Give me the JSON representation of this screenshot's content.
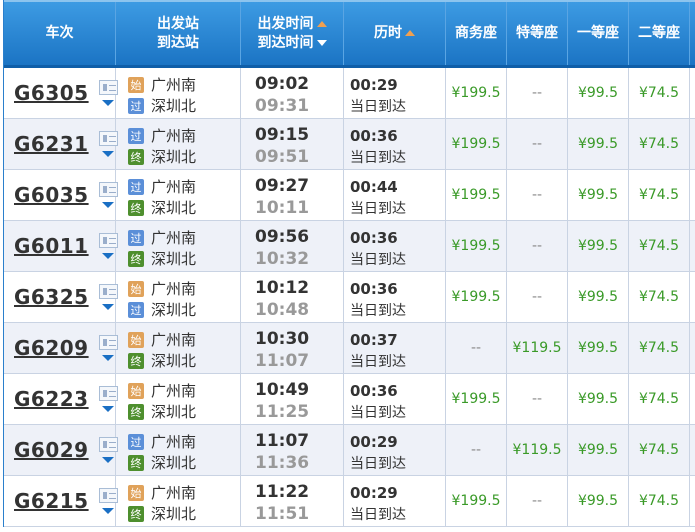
{
  "header": {
    "train": "车次",
    "station_dep": "出发站",
    "station_arr": "到达站",
    "time_dep": "出发时间",
    "time_arr": "到达时间",
    "duration": "历时",
    "business": "商务座",
    "premium": "特等座",
    "first": "一等座",
    "second": "二等座"
  },
  "badges": {
    "start": {
      "label": "始",
      "color": "#e0a25a"
    },
    "pass": {
      "label": "过",
      "color": "#5b8fd8"
    },
    "end": {
      "label": "终",
      "color": "#4e8f2e"
    }
  },
  "rows": [
    {
      "train": "G6305",
      "from": "广州南",
      "from_badge": "start",
      "to": "深圳北",
      "to_badge": "pass",
      "dep": "09:02",
      "arr": "09:31",
      "dur": "00:29",
      "arrival_note": "当日到达",
      "business": "¥199.5",
      "premium": "--",
      "first": "¥99.5",
      "second": "¥74.5"
    },
    {
      "train": "G6231",
      "from": "广州南",
      "from_badge": "pass",
      "to": "深圳北",
      "to_badge": "end",
      "dep": "09:15",
      "arr": "09:51",
      "dur": "00:36",
      "arrival_note": "当日到达",
      "business": "¥199.5",
      "premium": "--",
      "first": "¥99.5",
      "second": "¥74.5"
    },
    {
      "train": "G6035",
      "from": "广州南",
      "from_badge": "pass",
      "to": "深圳北",
      "to_badge": "end",
      "dep": "09:27",
      "arr": "10:11",
      "dur": "00:44",
      "arrival_note": "当日到达",
      "business": "¥199.5",
      "premium": "--",
      "first": "¥99.5",
      "second": "¥74.5"
    },
    {
      "train": "G6011",
      "from": "广州南",
      "from_badge": "pass",
      "to": "深圳北",
      "to_badge": "end",
      "dep": "09:56",
      "arr": "10:32",
      "dur": "00:36",
      "arrival_note": "当日到达",
      "business": "¥199.5",
      "premium": "--",
      "first": "¥99.5",
      "second": "¥74.5"
    },
    {
      "train": "G6325",
      "from": "广州南",
      "from_badge": "start",
      "to": "深圳北",
      "to_badge": "pass",
      "dep": "10:12",
      "arr": "10:48",
      "dur": "00:36",
      "arrival_note": "当日到达",
      "business": "¥199.5",
      "premium": "--",
      "first": "¥99.5",
      "second": "¥74.5"
    },
    {
      "train": "G6209",
      "from": "广州南",
      "from_badge": "start",
      "to": "深圳北",
      "to_badge": "end",
      "dep": "10:30",
      "arr": "11:07",
      "dur": "00:37",
      "arrival_note": "当日到达",
      "business": "--",
      "premium": "¥119.5",
      "first": "¥99.5",
      "second": "¥74.5"
    },
    {
      "train": "G6223",
      "from": "广州南",
      "from_badge": "start",
      "to": "深圳北",
      "to_badge": "end",
      "dep": "10:49",
      "arr": "11:25",
      "dur": "00:36",
      "arrival_note": "当日到达",
      "business": "¥199.5",
      "premium": "--",
      "first": "¥99.5",
      "second": "¥74.5"
    },
    {
      "train": "G6029",
      "from": "广州南",
      "from_badge": "pass",
      "to": "深圳北",
      "to_badge": "end",
      "dep": "11:07",
      "arr": "11:36",
      "dur": "00:29",
      "arrival_note": "当日到达",
      "business": "--",
      "premium": "¥119.5",
      "first": "¥99.5",
      "second": "¥74.5"
    },
    {
      "train": "G6215",
      "from": "广州南",
      "from_badge": "start",
      "to": "深圳北",
      "to_badge": "end",
      "dep": "11:22",
      "arr": "11:51",
      "dur": "00:29",
      "arrival_note": "当日到达",
      "business": "¥199.5",
      "premium": "--",
      "first": "¥99.5",
      "second": "¥74.5"
    }
  ]
}
